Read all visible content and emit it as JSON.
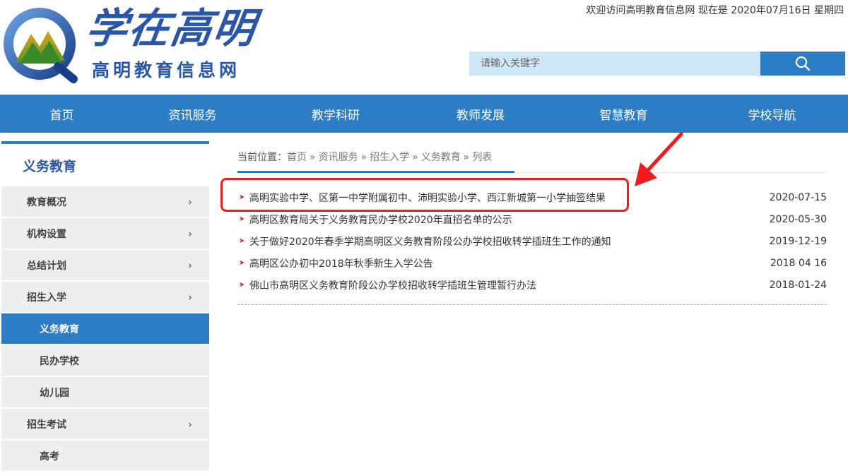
{
  "header": {
    "logo_title": "学在高明",
    "logo_subtitle": "高明教育信息网",
    "welcome": "欢迎访问高明教育信息网 现在是 2020年07月16日 星期四",
    "search_placeholder": "请输入关键字",
    "search_icon": "search-icon"
  },
  "nav": {
    "items": [
      "首页",
      "资讯服务",
      "教学科研",
      "教师发展",
      "智慧教育",
      "学校导航"
    ]
  },
  "sidebar": {
    "title": "义务教育",
    "items": [
      {
        "label": "教育概况",
        "chevron": "›"
      },
      {
        "label": "机构设置",
        "chevron": "›"
      },
      {
        "label": "总结计划",
        "chevron": "›"
      },
      {
        "label": "招生入学",
        "chevron": "›"
      },
      {
        "label": "义务教育",
        "chevron": ""
      },
      {
        "label": "民办学校",
        "chevron": ""
      },
      {
        "label": "幼儿园",
        "chevron": ""
      },
      {
        "label": "招生考试",
        "chevron": "›"
      },
      {
        "label": "高考",
        "chevron": ""
      }
    ]
  },
  "breadcrumb": {
    "label": "当前位置：",
    "items": [
      "首页",
      "资讯服务",
      "招生入学",
      "义务教育",
      "列表"
    ],
    "separator": "»"
  },
  "news": {
    "bullet": "➤",
    "items": [
      {
        "title": "高明实验中学、区第一中学附属初中、沛明实验小学、西江新城第一小学抽签结果",
        "date": "2020-07-15"
      },
      {
        "title": "高明区教育局关于义务教育民办学校2020年直招名单的公示",
        "date": "2020-05-30"
      },
      {
        "title": "关于做好2020年春季学期高明区义务教育阶段公办学校招收转学插班生工作的通知",
        "date": "2019-12-19"
      },
      {
        "title": "高明区公办初中2018年秋季新生入学公告",
        "date": "2018 04 16"
      },
      {
        "title": "佛山市高明区义务教育阶段公办学校招收转学插班生管理暂行办法",
        "date": "2018-01-24"
      }
    ]
  },
  "colors": {
    "brand_blue": "#2d7dc4",
    "logo_blue": "#2a56a8",
    "search_bg": "#cde6f8",
    "annotation_red": "#ee1c1c"
  }
}
